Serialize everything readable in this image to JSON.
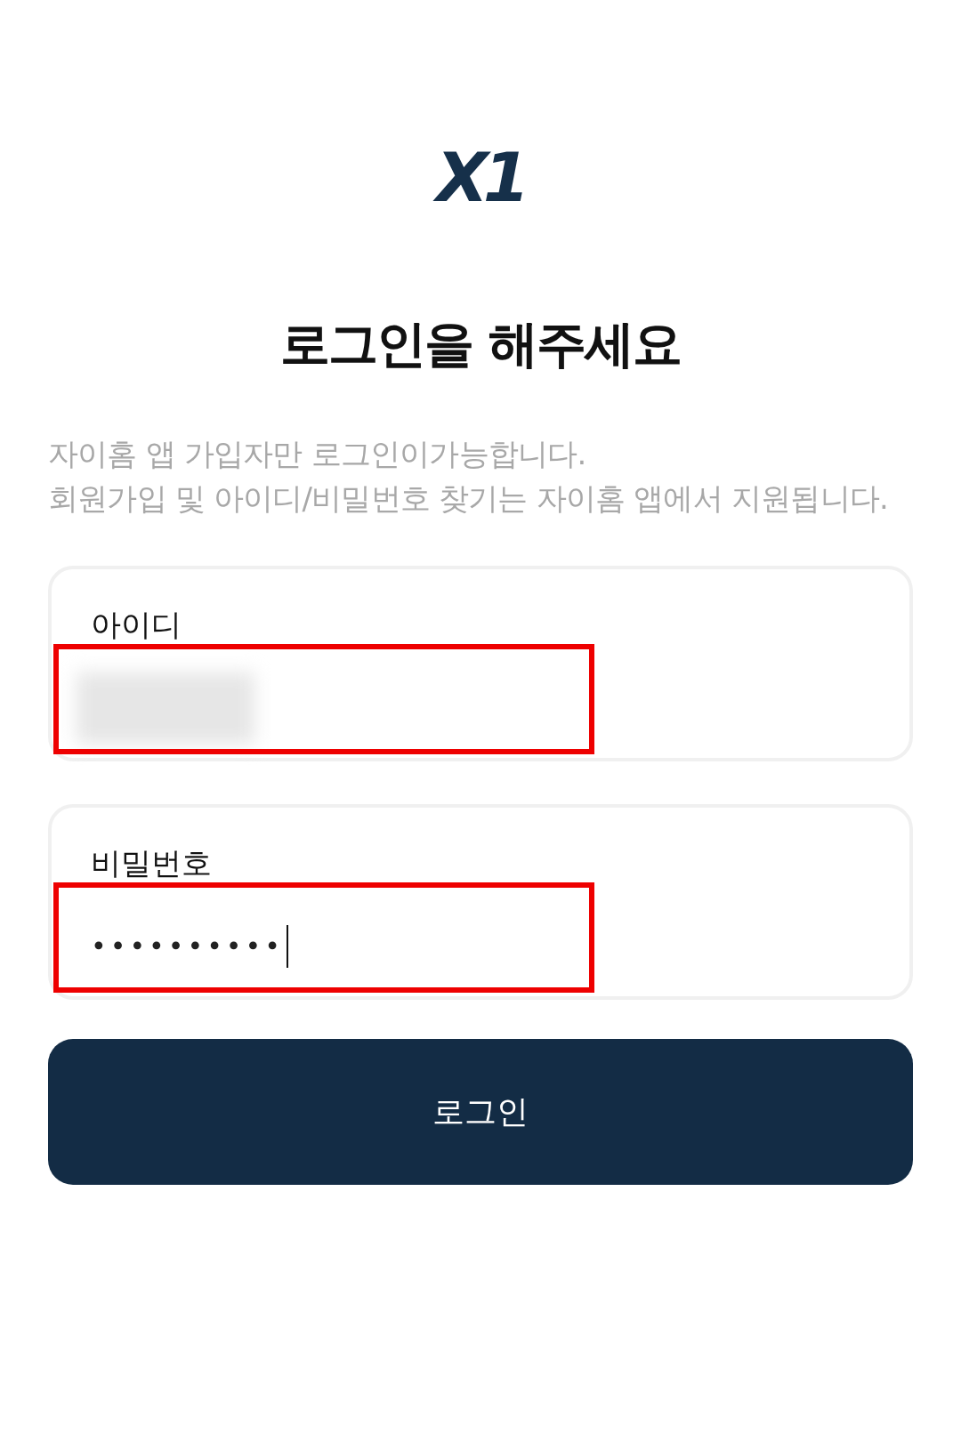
{
  "logo": {
    "text": "X1"
  },
  "title": "로그인을 해주세요",
  "notice": [
    "자이홈 앱 가입자만 로그인이가능합니다.",
    "회원가입 및 아이디/비밀번호 찾기는 자이홈 앱에서 지원됩니다."
  ],
  "fields": [
    {
      "label": "아이디",
      "redacted": true,
      "highlighted": true
    },
    {
      "label": "비밀번호",
      "value": "••••••••••",
      "focused": true,
      "highlighted": true
    }
  ],
  "button": {
    "label": "로그인"
  }
}
